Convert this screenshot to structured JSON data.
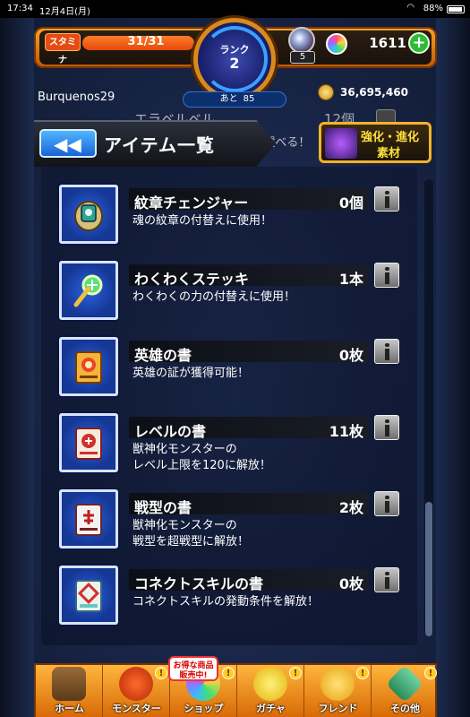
{
  "status_bar": {
    "time": "17:34",
    "date": "12月4日(月)",
    "battery": "88%"
  },
  "hud": {
    "stamina_label": "スタミナ",
    "stamina_value": "31/31",
    "rank_label": "ランク",
    "rank_value": "2",
    "orb_badge": "5",
    "gem_count": "1611",
    "next_label": "あと",
    "next_value": "85",
    "username": "Burquenos29",
    "coins": "36,695,460"
  },
  "behind_row": {
    "name": "エラベルベル",
    "desc": "ーンを選べる！",
    "count": "12個"
  },
  "header": {
    "back_label": "◀◀",
    "title": "アイテム一覧"
  },
  "evolve_button": {
    "line1": "強化・進化",
    "line2": "素材"
  },
  "items": [
    {
      "name": "紋章チェンジャー",
      "count": "0個",
      "desc": "魂の紋章の付替えに使用！",
      "icon": "crest-changer-icon"
    },
    {
      "name": "わくわくステッキ",
      "count": "1本",
      "desc": "わくわくの力の付替えに使用！",
      "icon": "wand-icon"
    },
    {
      "name": "英雄の書",
      "count": "0枚",
      "desc": "英雄の証が獲得可能！",
      "icon": "hero-book-icon"
    },
    {
      "name": "レベルの書",
      "count": "11枚",
      "desc": "獣神化モンスターの\nレベル上限を120に解放！",
      "icon": "level-book-icon"
    },
    {
      "name": "戦型の書",
      "count": "2枚",
      "desc": "獣神化モンスターの\n戦型を超戦型に解放！",
      "icon": "battle-type-book-icon"
    },
    {
      "name": "コネクトスキルの書",
      "count": "0枚",
      "desc": "コネクトスキルの発動条件を解放！",
      "icon": "connect-skill-book-icon"
    }
  ],
  "promo": {
    "line1": "お得な商品",
    "line2": "販売中!"
  },
  "nav": [
    {
      "label": "ホーム",
      "icon": "home-icon"
    },
    {
      "label": "モンスター",
      "icon": "monster-icon"
    },
    {
      "label": "ショップ",
      "icon": "shop-icon"
    },
    {
      "label": "ガチャ",
      "icon": "gacha-icon"
    },
    {
      "label": "フレンド",
      "icon": "friend-icon"
    },
    {
      "label": "その他",
      "icon": "other-icon"
    }
  ]
}
